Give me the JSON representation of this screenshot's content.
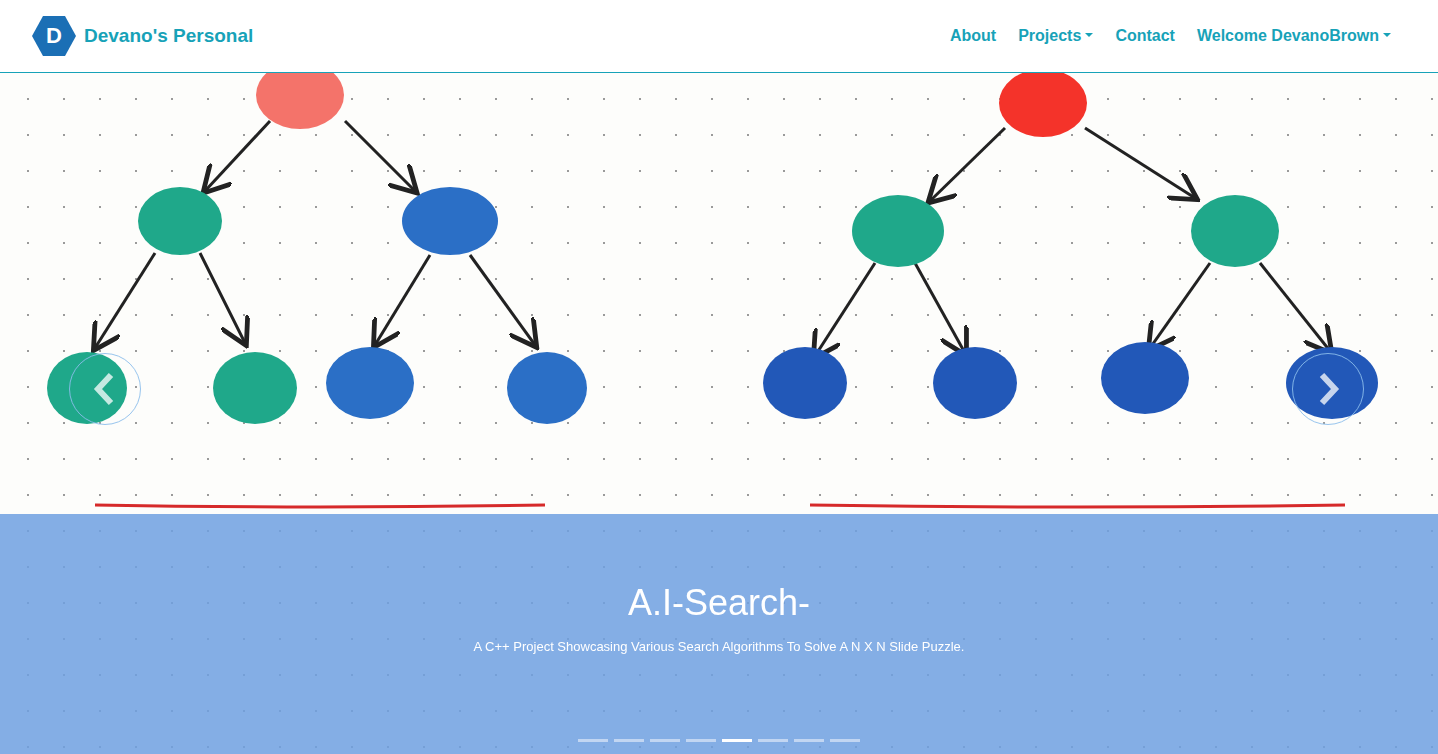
{
  "brand": {
    "logo": "D",
    "title": "Devano's Personal"
  },
  "nav": [
    {
      "label": "About",
      "dropdown": false
    },
    {
      "label": "Projects",
      "dropdown": true
    },
    {
      "label": "Contact",
      "dropdown": false
    },
    {
      "label": "Welcome DevanoBrown",
      "dropdown": true
    }
  ],
  "carousel": {
    "caption": {
      "title": "A.I-Search-",
      "text": "A C++ Project Showcasing Various Search Algorithms To Solve A N X N Slide Puzzle."
    },
    "indicators": [
      {
        "selected": false
      },
      {
        "selected": false
      },
      {
        "selected": false
      },
      {
        "selected": false
      },
      {
        "selected": true
      },
      {
        "selected": false
      },
      {
        "selected": false
      },
      {
        "selected": false
      }
    ]
  }
}
